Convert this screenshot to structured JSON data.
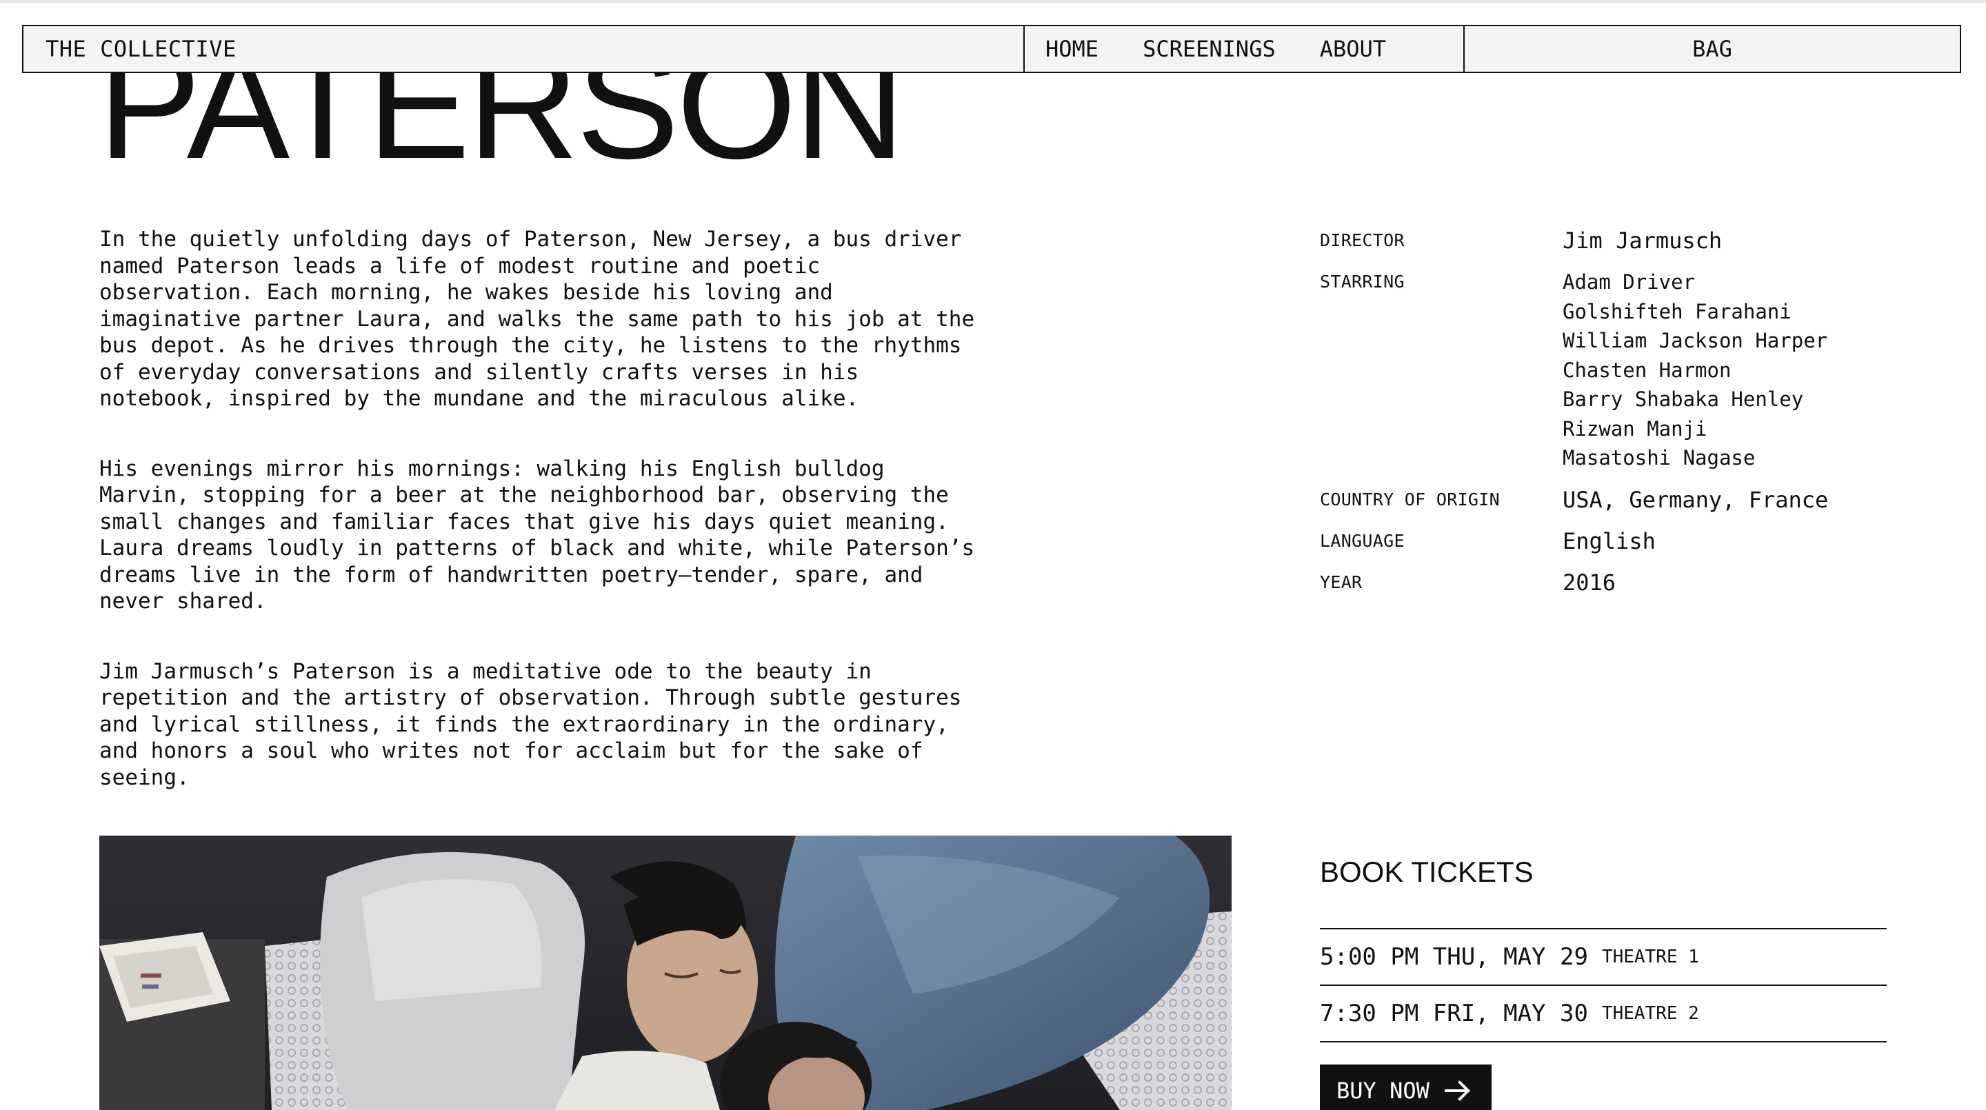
{
  "nav": {
    "brand": "THE COLLECTIVE",
    "links": [
      "HOME",
      "SCREENINGS",
      "ABOUT"
    ],
    "bag": "BAG"
  },
  "film": {
    "title": "PATERSON",
    "synopsis": [
      "In the quietly unfolding days of Paterson, New Jersey, a bus driver named Paterson leads a life of modest routine and poetic observation. Each morning, he wakes beside his loving and imaginative partner Laura, and walks the same path to his job at the bus depot. As he drives through the city, he listens to the rhythms of everyday conversations and silently crafts verses in his notebook, inspired by the mundane and the miraculous alike.",
      "His evenings mirror his mornings: walking his English bulldog Marvin, stopping for a beer at the neighborhood bar, observing the small changes and familiar faces that give his days quiet meaning. Laura dreams loudly in patterns of black and white, while Paterson’s dreams live in the form of handwritten poetry—tender, spare, and never shared.",
      "Jim Jarmusch’s Paterson is a meditative ode to the beauty in repetition and the artistry of observation. Through subtle gestures and lyrical stillness, it finds the extraordinary in the ordinary, and honors a soul who writes not for acclaim but for the sake of seeing."
    ],
    "synopsis_lines": [
      "In the quietly unfolding days of Paterson, New Jersey, a bus driver\nnamed Paterson leads a life of modest routine and poetic\nobservation. Each morning, he wakes beside his loving and\nimaginative partner Laura, and walks the same path to his job at the\nbus depot. As he drives through the city, he listens to the rhythms\nof everyday conversations and silently crafts verses in his\nnotebook, inspired by the mundane and the miraculous alike.",
      "His evenings mirror his mornings: walking his English bulldog\nMarvin, stopping for a beer at the neighborhood bar, observing the\nsmall changes and familiar faces that give his days quiet meaning.\nLaura dreams loudly in patterns of black and white, while Paterson’s\ndreams live in the form of handwritten poetry—tender, spare, and\nnever shared.",
      "Jim Jarmusch’s Paterson is a meditative ode to the beauty in\nrepetition and the artistry of observation. Through subtle gestures\nand lyrical stillness, it finds the extraordinary in the ordinary,\nand honors a soul who writes not for acclaim but for the sake of\nseeing."
    ],
    "credits": {
      "director": {
        "label": "DIRECTOR",
        "value": "Jim Jarmusch"
      },
      "starring": {
        "label": "STARRING",
        "values": [
          "Adam Driver",
          "Golshifteh Farahani",
          "William Jackson Harper",
          "Chasten Harmon",
          "Barry Shabaka Henley",
          "Rizwan Manji",
          "Masatoshi Nagase"
        ]
      },
      "country": {
        "label": "COUNTRY OF ORIGIN",
        "value": "USA, Germany, France"
      },
      "language": {
        "label": "LANGUAGE",
        "value": "English"
      },
      "year": {
        "label": "YEAR",
        "value": "2016"
      }
    }
  },
  "booking": {
    "title": "BOOK TICKETS",
    "showtimes": [
      {
        "when": "5:00 PM THU, MAY 29",
        "theatre": "THEATRE 1"
      },
      {
        "when": "7:30 PM FRI, MAY 30",
        "theatre": "THEATRE 2"
      }
    ],
    "buy_label": "BUY NOW",
    "buy_icon": "arrow-right-icon"
  },
  "colors": {
    "ink": "#111111",
    "header_bg": "#f3f3f3",
    "page_bg": "#ffffff"
  }
}
